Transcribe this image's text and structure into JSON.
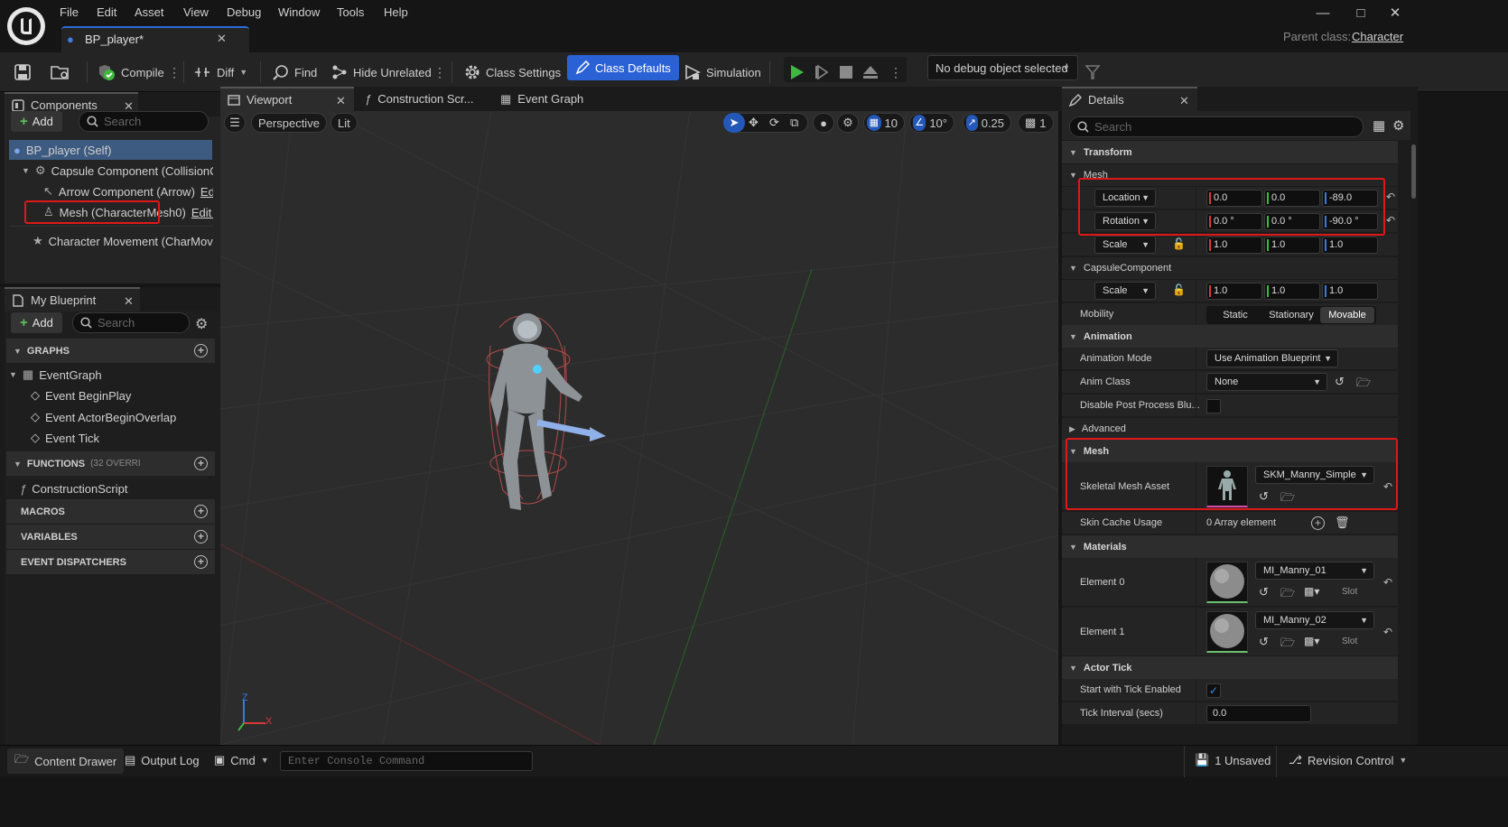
{
  "app": {
    "logo": "unreal-logo"
  },
  "menu": [
    "File",
    "Edit",
    "Asset",
    "View",
    "Debug",
    "Window",
    "Tools",
    "Help"
  ],
  "document_tab": {
    "title": "BP_player*"
  },
  "parent_class": {
    "label": "Parent class:",
    "value": "Character"
  },
  "toolbar": {
    "compile": "Compile",
    "diff": "Diff",
    "find": "Find",
    "hide_unrelated": "Hide Unrelated",
    "class_settings": "Class Settings",
    "class_defaults": "Class Defaults",
    "simulation": "Simulation",
    "debug_object": "No debug object selected"
  },
  "components_panel": {
    "tab": "Components",
    "add": "Add",
    "search_placeholder": "Search",
    "items": [
      {
        "label": "BP_player (Self)"
      },
      {
        "label": "Capsule Component (CollisionCyl"
      },
      {
        "label": "Arrow Component (Arrow)",
        "edit": "Edit"
      },
      {
        "label": "Mesh (CharacterMesh0)",
        "edit": "Edit in"
      },
      {
        "label": "Character Movement (CharMove"
      }
    ]
  },
  "my_blueprint": {
    "tab": "My Blueprint",
    "add": "Add",
    "search_placeholder": "Search",
    "graphs_header": "GRAPHS",
    "event_graph": "EventGraph",
    "events": [
      "Event BeginPlay",
      "Event ActorBeginOverlap",
      "Event Tick"
    ],
    "functions_header": "FUNCTIONS",
    "functions_count": "(32 OVERRI",
    "construction_script": "ConstructionScript",
    "macros_header": "MACROS",
    "variables_header": "VARIABLES",
    "dispatchers_header": "EVENT DISPATCHERS"
  },
  "editor_tabs": {
    "viewport": "Viewport",
    "construction": "Construction Scr...",
    "event_graph": "Event Graph"
  },
  "viewport": {
    "perspective": "Perspective",
    "lit": "Lit",
    "grid_snap": "10",
    "rotation_snap": "10°",
    "scale_snap": "0.25",
    "camera_speed": "1",
    "axis_x": "X",
    "axis_z": "Z"
  },
  "details": {
    "tab": "Details",
    "search_placeholder": "Search",
    "transform": {
      "header": "Transform",
      "mesh_sub": "Mesh",
      "location_label": "Location",
      "location": [
        "0.0",
        "0.0",
        "-89.0"
      ],
      "rotation_label": "Rotation",
      "rotation": [
        "0.0 °",
        "0.0 °",
        "-90.0 °"
      ],
      "scale_label": "Scale",
      "scale": [
        "1.0",
        "1.0",
        "1.0"
      ],
      "capsule_sub": "CapsuleComponent",
      "capsule_scale_label": "Scale",
      "capsule_scale": [
        "1.0",
        "1.0",
        "1.0"
      ],
      "mobility_label": "Mobility",
      "mobility_options": [
        "Static",
        "Stationary",
        "Movable"
      ]
    },
    "animation": {
      "header": "Animation",
      "mode_label": "Animation Mode",
      "mode_value": "Use Animation Blueprint",
      "class_label": "Anim Class",
      "class_value": "None",
      "disable_pp_label": "Disable Post Process Blu...",
      "advanced": "Advanced"
    },
    "mesh": {
      "header": "Mesh",
      "skeletal_label": "Skeletal Mesh Asset",
      "skeletal_value": "SKM_Manny_Simple",
      "skin_cache_label": "Skin Cache Usage",
      "skin_cache_value": "0 Array element"
    },
    "materials": {
      "header": "Materials",
      "elements": [
        {
          "label": "Element 0",
          "value": "MI_Manny_01",
          "slot": "Slot"
        },
        {
          "label": "Element 1",
          "value": "MI_Manny_02",
          "slot": "Slot"
        }
      ]
    },
    "actor_tick": {
      "header": "Actor Tick",
      "start_label": "Start with Tick Enabled",
      "interval_label": "Tick Interval (secs)",
      "interval_value": "0.0"
    }
  },
  "status_bar": {
    "content_drawer": "Content Drawer",
    "output_log": "Output Log",
    "cmd": "Cmd",
    "console_placeholder": "Enter Console Command",
    "unsaved": "1 Unsaved",
    "revision_control": "Revision Control"
  },
  "colors": {
    "accent_blue": "#2a62d6",
    "highlight_red": "#e01818",
    "play_green": "#3fb83f"
  }
}
